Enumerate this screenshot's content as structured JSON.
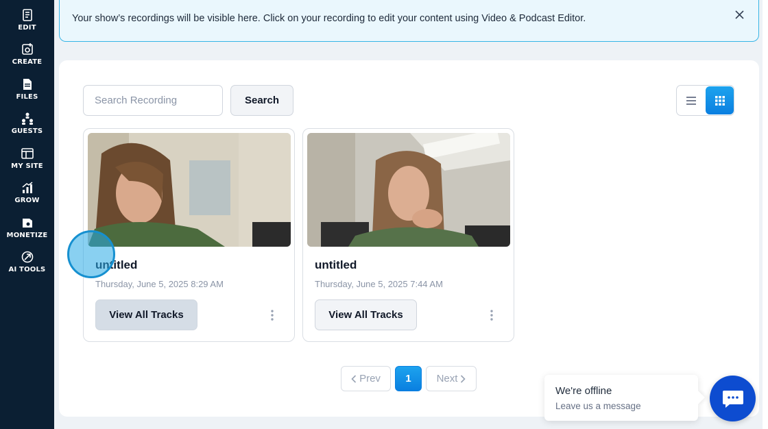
{
  "sidebar": {
    "items": [
      {
        "label": "EDIT",
        "icon": "edit-icon"
      },
      {
        "label": "CREATE",
        "icon": "create-icon"
      },
      {
        "label": "FILES",
        "icon": "files-icon"
      },
      {
        "label": "GUESTS",
        "icon": "guests-icon"
      },
      {
        "label": "MY SITE",
        "icon": "my-site-icon"
      },
      {
        "label": "GROW",
        "icon": "grow-icon"
      },
      {
        "label": "MONETIZE",
        "icon": "monetize-icon"
      },
      {
        "label": "AI TOOLS",
        "icon": "ai-tools-icon"
      }
    ]
  },
  "banner": {
    "text": "Your show’s recordings will be visible here. Click on your recording to edit your content using Video & Podcast Editor."
  },
  "toolbar": {
    "search_placeholder": "Search Recording",
    "search_label": "Search",
    "view_mode": "grid"
  },
  "recordings": [
    {
      "title": "untitled",
      "date": "Thursday, June 5, 2025 8:29 AM",
      "button": "View All Tracks"
    },
    {
      "title": "untitled",
      "date": "Thursday, June 5, 2025 7:44 AM",
      "button": "View All Tracks"
    }
  ],
  "pagination": {
    "prev": "Prev",
    "current": "1",
    "next": "Next"
  },
  "chat": {
    "title": "We're offline",
    "subtitle": "Leave us a message"
  },
  "colors": {
    "sidebar": "#0b1f33",
    "accent": "#0a7fe0",
    "banner_border": "#35b4e6",
    "chat": "#0d4cd0"
  }
}
